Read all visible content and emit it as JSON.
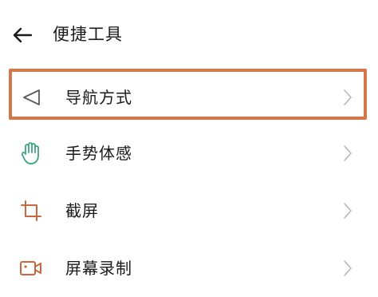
{
  "header": {
    "title": "便捷工具",
    "back_icon": "arrow-left-icon"
  },
  "menu": {
    "items": [
      {
        "label": "导航方式",
        "icon": "navigation-triangle-icon",
        "icon_color": "#5a5a5a",
        "highlighted": true
      },
      {
        "label": "手势体感",
        "icon": "hand-gesture-icon",
        "icon_color": "#3aa57a"
      },
      {
        "label": "截屏",
        "icon": "crop-icon",
        "icon_color": "#c9663e"
      },
      {
        "label": "屏幕录制",
        "icon": "video-camera-icon",
        "icon_color": "#c9663e"
      }
    ]
  },
  "colors": {
    "highlight_border": "#d4784a",
    "chevron": "#b8b8b8",
    "text": "#1a1a1a"
  }
}
